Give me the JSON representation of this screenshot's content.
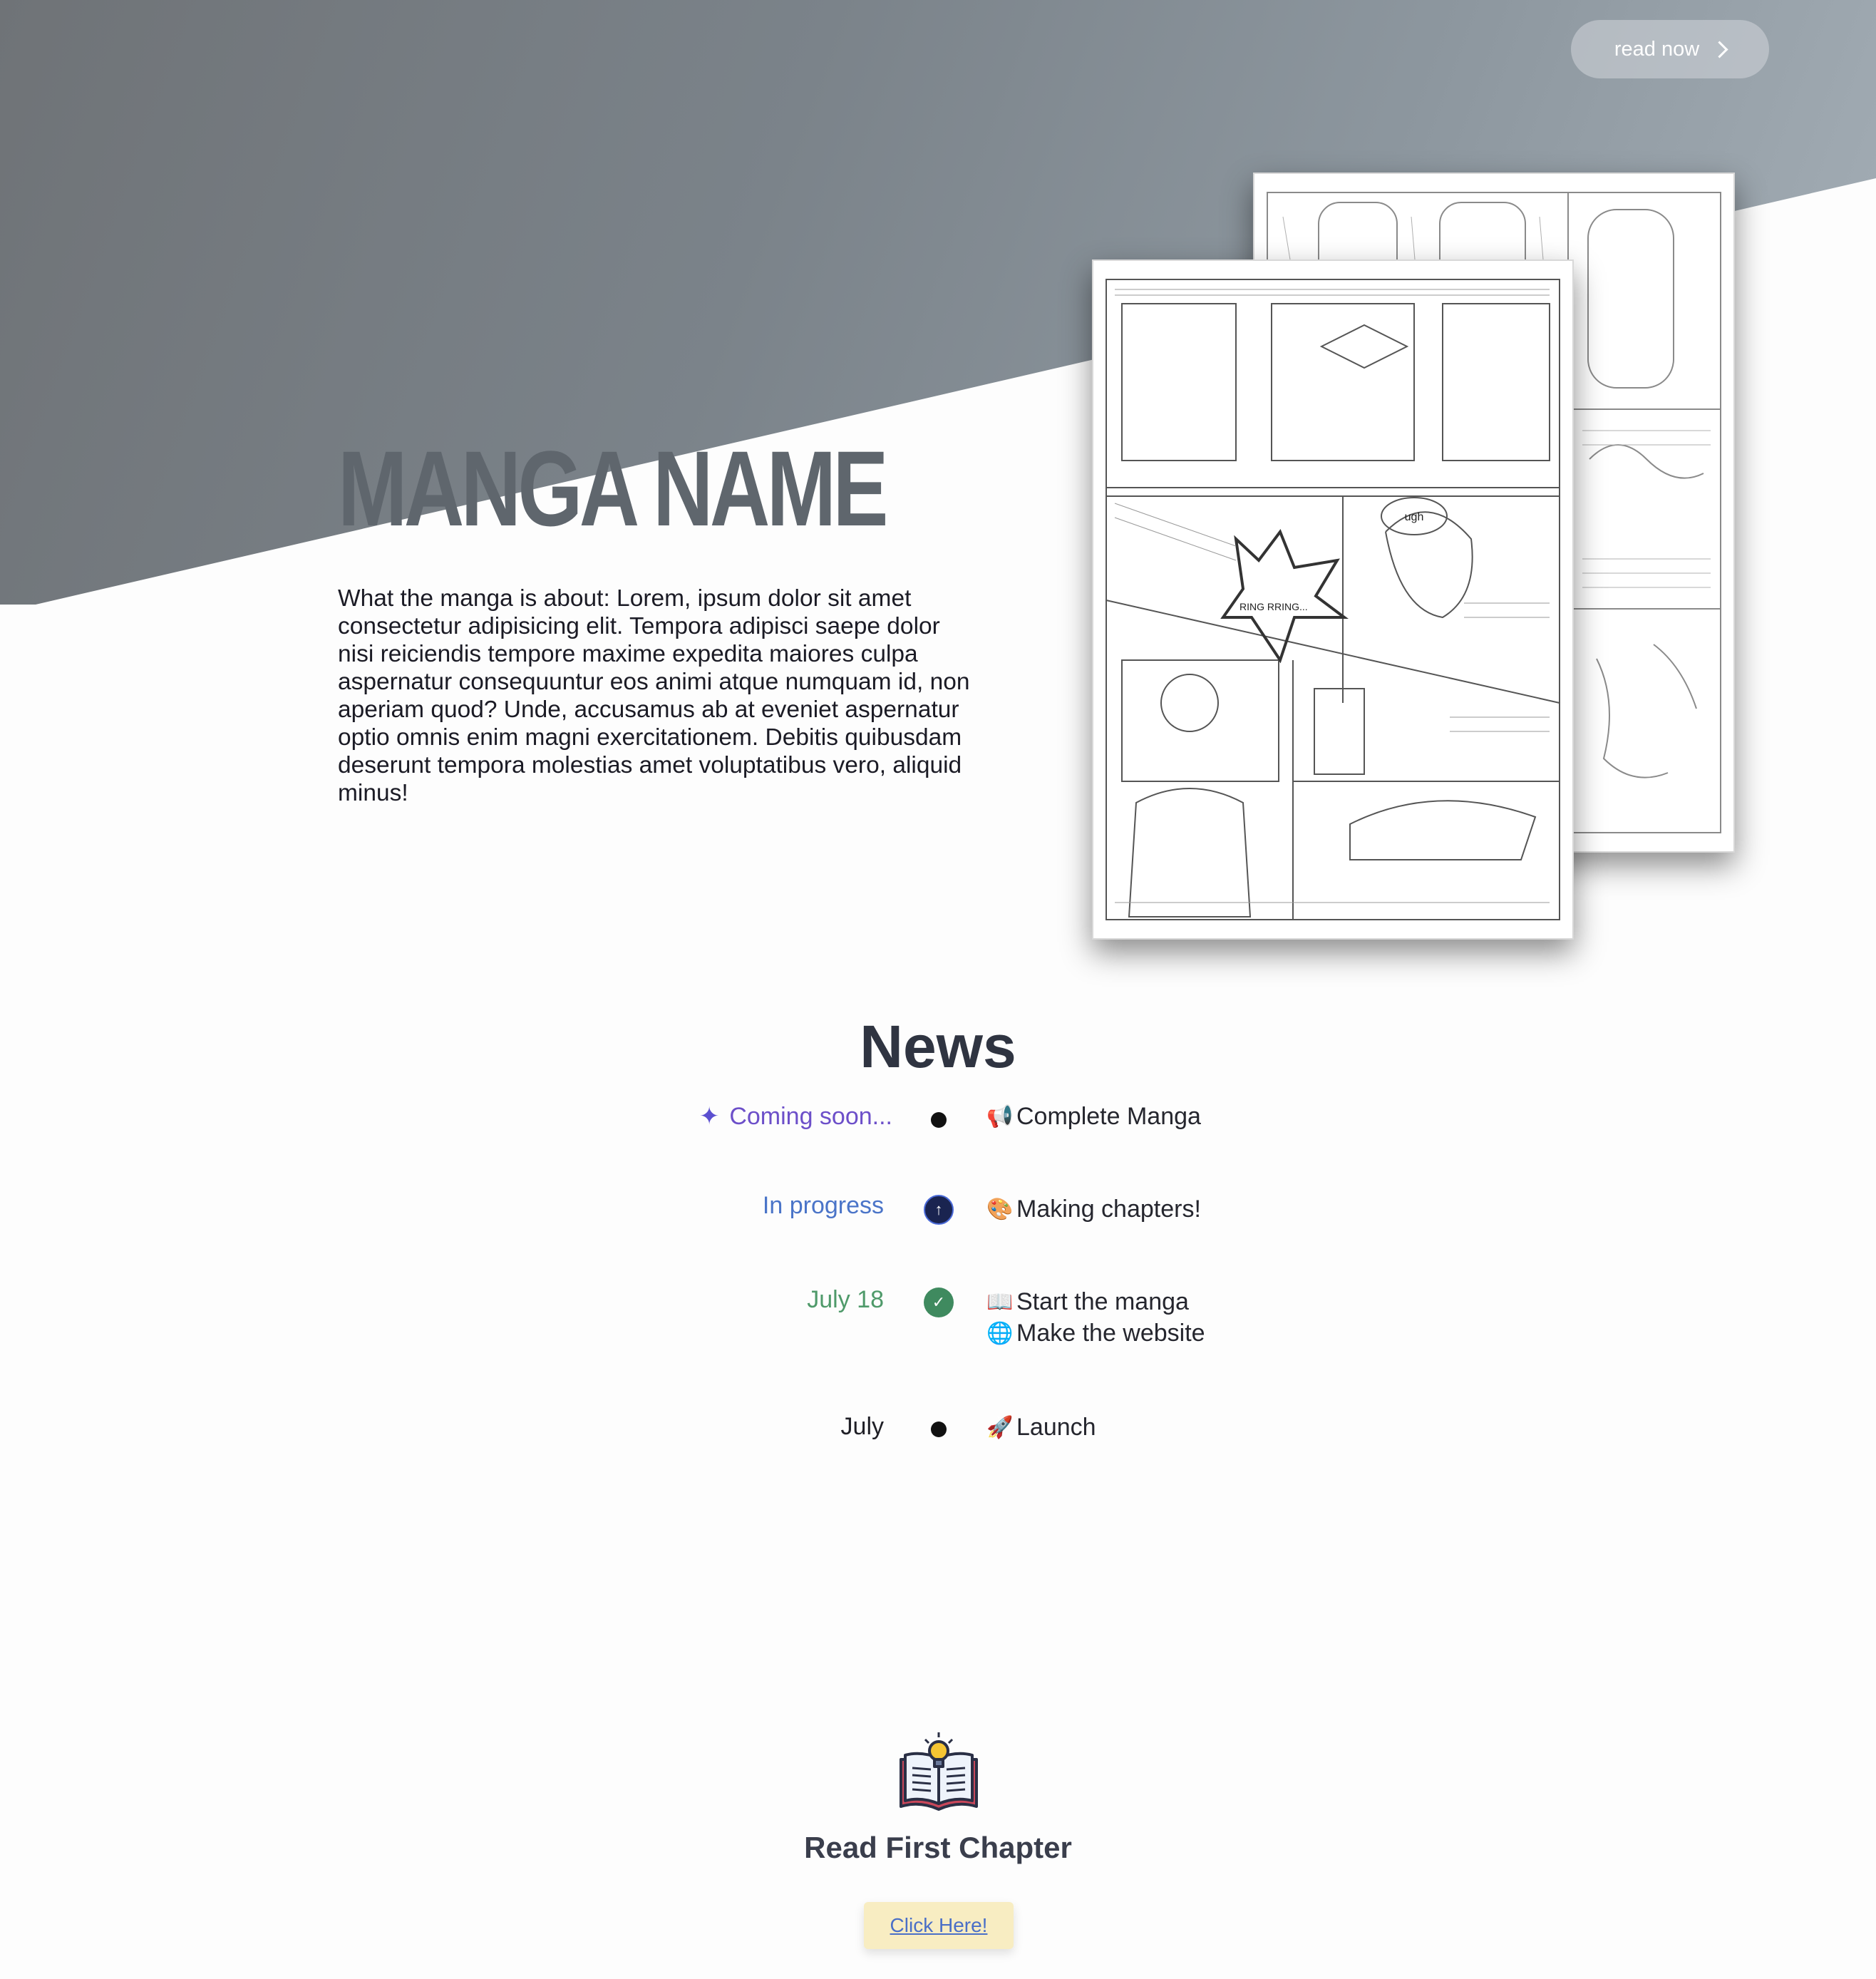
{
  "header": {
    "read_now_label": "read now"
  },
  "hero": {
    "title": "MANGA NAME",
    "description": "What the manga is about: Lorem, ipsum dolor sit amet consectetur adipisicing elit. Tempora adipisci saepe dolor nisi reiciendis tempore maxime expedita maiores culpa aspernatur consequuntur eos animi atque numquam id, non aperiam quod? Unde, accusamus ab at eveniet aspernatur optio omnis enim magni exercitationem. Debitis quibusdam deserunt tempora molestias amet voluptatibus vero, aliquid minus!",
    "art_lettering": {
      "speech_bubble": "ugh",
      "sound_effect": "RING RRING..."
    }
  },
  "news": {
    "title": "News",
    "items": [
      {
        "label": "Coming soon...",
        "label_color": "#6c4fc9",
        "label_icon": "sparkle-icon",
        "marker": "dot",
        "entries": [
          {
            "icon": "megaphone-icon",
            "glyph": "📢",
            "text": "Complete Manga"
          }
        ]
      },
      {
        "label": "In progress",
        "label_color": "#4a74c8",
        "marker": "progress-arrow",
        "marker_color": "#2c3e8c",
        "entries": [
          {
            "icon": "palette-icon",
            "glyph": "🎨",
            "text": "Making chapters!"
          }
        ]
      },
      {
        "label": "July 18",
        "label_color": "#4f9a6a",
        "marker": "check",
        "marker_color": "#3f8a5f",
        "entries": [
          {
            "icon": "open-book-icon",
            "glyph": "📖",
            "text": "Start the manga"
          },
          {
            "icon": "globe-icon",
            "glyph": "🌐",
            "text": "Make the website"
          }
        ]
      },
      {
        "label": "July",
        "label_color": "#1f1f26",
        "marker": "dot",
        "entries": [
          {
            "icon": "rocket-icon",
            "glyph": "🚀",
            "text": "Launch"
          }
        ]
      }
    ]
  },
  "cta": {
    "icon": "book-lightbulb-icon",
    "title": "Read First Chapter",
    "button_label": "Click Here!"
  },
  "colors": {
    "hero_gradient_start": "#6f7377",
    "hero_gradient_end": "#a6b0b8",
    "title_color": "#5f666d",
    "cta_button_bg": "#f8edc2"
  }
}
